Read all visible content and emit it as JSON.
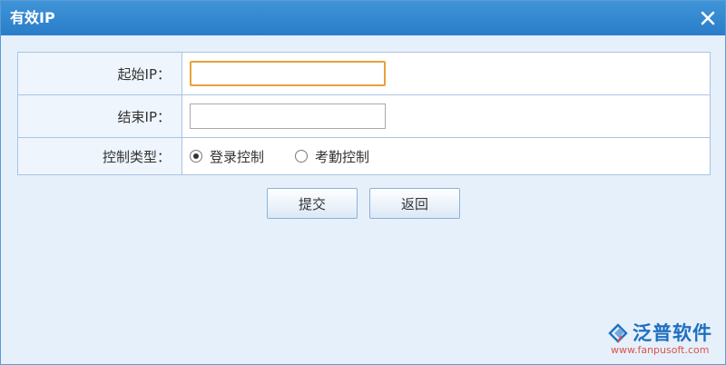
{
  "dialog": {
    "title": "有效IP",
    "close_icon": "close-icon"
  },
  "form": {
    "start_ip": {
      "label": "起始IP：",
      "value": "",
      "placeholder": ""
    },
    "end_ip": {
      "label": "结束IP：",
      "value": "",
      "placeholder": ""
    },
    "control_type": {
      "label": "控制类型：",
      "options": [
        {
          "label": "登录控制",
          "checked": true
        },
        {
          "label": "考勤控制",
          "checked": false
        }
      ]
    }
  },
  "buttons": {
    "submit_label": "提交",
    "back_label": "返回"
  },
  "watermark": {
    "brand": "泛普软件",
    "url": "www.fanpusoft.com"
  },
  "colors": {
    "titlebar": "#2a7cc8",
    "dialog_bg": "#e6f0fb",
    "focus_border": "#e8a23a",
    "brand": "#1f6fbf"
  }
}
